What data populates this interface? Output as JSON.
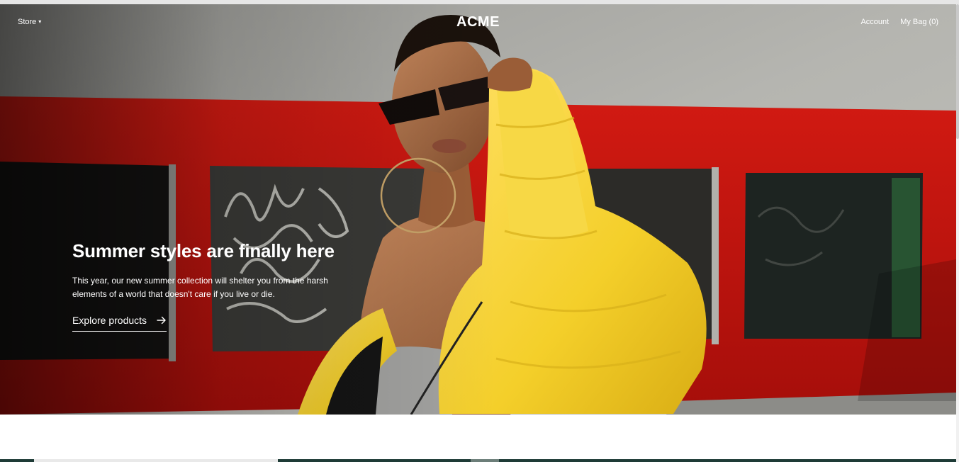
{
  "header": {
    "store_label": "Store",
    "logo": "ACME",
    "account_label": "Account",
    "bag_label": "My Bag (0)"
  },
  "hero": {
    "title": "Summer styles are finally here",
    "text": "This year, our new summer collection will shelter you from the harsh elements of a world that doesn't care if you live or die.",
    "cta_label": "Explore products"
  },
  "icons": {
    "store_caret": "chevron-down-icon",
    "cta_arrow": "arrow-right-icon"
  },
  "colors": {
    "header_text": "#ffffff",
    "frame_red": "#c8130f",
    "jacket_yellow": "#f6d12f",
    "wall": "#a9a9a4",
    "below_strip": "#1e3b36"
  }
}
